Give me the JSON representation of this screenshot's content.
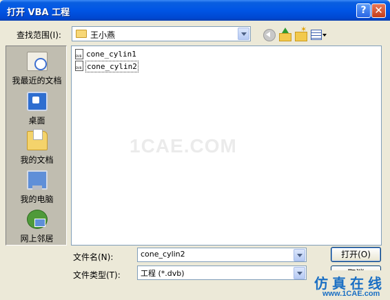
{
  "window": {
    "title": "打开 VBA 工程",
    "help_label": "?",
    "close_label": "✕"
  },
  "lookin": {
    "label": "查找范围(I):",
    "value": "王小燕"
  },
  "toolbar": {
    "icons": [
      "back-icon",
      "up-folder-icon",
      "new-folder-icon",
      "view-menu-icon"
    ]
  },
  "places": [
    {
      "label": "我最近的文档",
      "icon": "recent-documents-icon"
    },
    {
      "label": "桌面",
      "icon": "desktop-icon"
    },
    {
      "label": "我的文档",
      "icon": "my-documents-icon"
    },
    {
      "label": "我的电脑",
      "icon": "my-computer-icon"
    },
    {
      "label": "网上邻居",
      "icon": "network-places-icon"
    }
  ],
  "files": [
    {
      "name": "cone_cylin1",
      "selected": false
    },
    {
      "name": "cone_cylin2",
      "selected": true
    }
  ],
  "watermark": "1CAE.COM",
  "filename": {
    "label": "文件名(N):",
    "value": "cone_cylin2"
  },
  "filetype": {
    "label": "文件类型(T):",
    "value": "工程 (*.dvb)"
  },
  "buttons": {
    "open": "打开(O)",
    "cancel": "取消"
  },
  "corner_logo": {
    "text": "仿真在线",
    "url": "www.1CAE.com"
  }
}
